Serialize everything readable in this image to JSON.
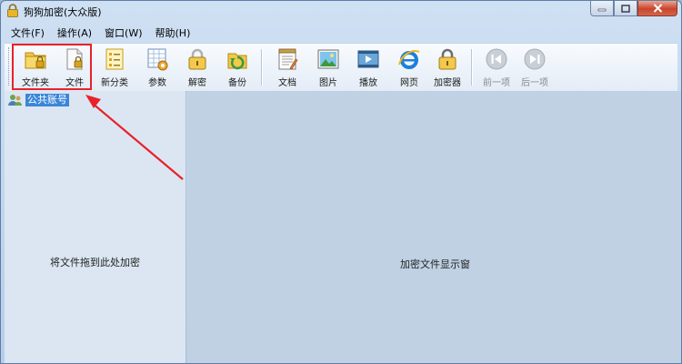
{
  "window": {
    "title": "狗狗加密(大众版)"
  },
  "menu": [
    {
      "label": "文件(F)"
    },
    {
      "label": "操作(A)"
    },
    {
      "label": "窗口(W)"
    },
    {
      "label": "帮助(H)"
    }
  ],
  "toolbar": {
    "folder": "文件夹",
    "file": "文件",
    "new_category": "新分类",
    "params": "参数",
    "decrypt": "解密",
    "backup": "备份",
    "document": "文档",
    "picture": "图片",
    "play": "播放",
    "webpage": "网页",
    "encryptor": "加密器",
    "prev": "前一项",
    "next": "后一项"
  },
  "tree": {
    "public_accounts": "公共账号"
  },
  "left_pane": {
    "hint": "将文件拖到此处加密"
  },
  "right_pane": {
    "hint": "加密文件显示窗"
  },
  "colors": {
    "highlight": "#e8222a",
    "selection": "#3b86d8",
    "right_pane_bg": "#bfd1e3",
    "left_pane_bg": "#dbe6f2"
  }
}
